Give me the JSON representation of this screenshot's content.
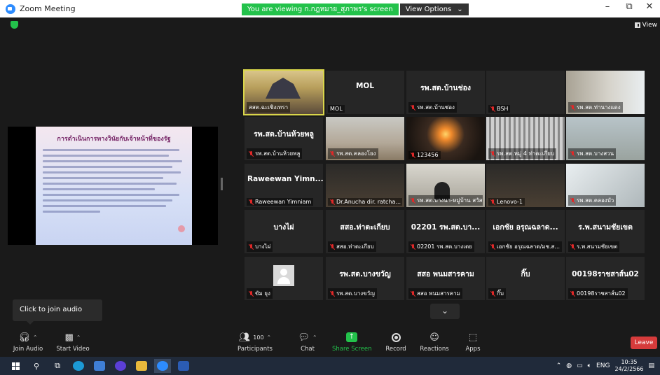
{
  "window": {
    "title": "Zoom Meeting",
    "minimize": "–",
    "maximize": "⧉",
    "close": "✕"
  },
  "banner": {
    "sharing_text": "You are viewing ก.กฎหมาย_สุภาพร's screen",
    "view_options": "View Options",
    "view_options_caret": "⌄"
  },
  "view_button": {
    "label": "View"
  },
  "slide": {
    "title": "การดำเนินการทางวินัยกับเจ้าหน้าที่ของรัฐ"
  },
  "gallery": {
    "tiles": [
      {
        "name": "",
        "label": "สสต.ฉะเชิงเทรา",
        "video": "v-bridge",
        "active": true,
        "muted": false
      },
      {
        "name": "MOL",
        "label": "MOL",
        "video": "",
        "active": false,
        "muted": false
      },
      {
        "name": "รพ.สต.บ้านช่อง",
        "label": "รพ.สต.บ้านช่อง",
        "video": "",
        "active": false,
        "muted": true
      },
      {
        "name": "",
        "label": "BSH",
        "video": "",
        "active": false,
        "muted": true
      },
      {
        "name": "",
        "label": "รพ.สต.ท่านางแดง",
        "video": "v-shelf",
        "active": false,
        "muted": true
      },
      {
        "name": "รพ.สต.บ้านห้วยพลู",
        "label": "รพ.สต.บ้านห้วยพลู",
        "video": "",
        "active": false,
        "muted": true
      },
      {
        "name": "",
        "label": "รพ.สต.คลองโยง",
        "video": "v-room",
        "active": false,
        "muted": true
      },
      {
        "name": "",
        "label": "123456",
        "video": "v-sun",
        "active": false,
        "muted": true
      },
      {
        "name": "",
        "label": "รพ.สต.หมู่ 4 ท่าตะเกียบ",
        "video": "v-curtain",
        "active": false,
        "muted": true
      },
      {
        "name": "",
        "label": "รพ.สต.บางสวน",
        "video": "v-office",
        "active": false,
        "muted": true
      },
      {
        "name": "Raweewan Yimn...",
        "label": "Raweewan Yimniam",
        "video": "",
        "active": false,
        "muted": true
      },
      {
        "name": "",
        "label": "Dr.Anucha  dir. ratcha...",
        "video": "v-dark",
        "active": false,
        "muted": true
      },
      {
        "name": "",
        "label": "รพ.สต.บางนา-หมู่บ้าน สวัสดิ์",
        "video": "v-meet",
        "active": false,
        "muted": true
      },
      {
        "name": "",
        "label": "Lenovo-1",
        "video": "v-dark",
        "active": false,
        "muted": true
      },
      {
        "name": "",
        "label": "รพ.สต.คลองบัว",
        "video": "v-window",
        "active": false,
        "muted": true
      },
      {
        "name": "บางไผ่",
        "label": "บางไผ่",
        "video": "",
        "active": false,
        "muted": true
      },
      {
        "name": "สสอ.ท่าตะเกียบ",
        "label": "สสอ.ท่าตะเกียบ",
        "video": "",
        "active": false,
        "muted": true
      },
      {
        "name": "02201 รพ.สต.บา...",
        "label": "02201 รพ.สต.บางเตย",
        "video": "",
        "active": false,
        "muted": true
      },
      {
        "name": "เอกชัย อรุณฉลาด...",
        "label": "เอกชัย อรุณฉลาด/มช.ส...",
        "video": "",
        "active": false,
        "muted": true
      },
      {
        "name": "ร.พ.สนามชัยเขต",
        "label": "ร.พ.สนามชัยเขต",
        "video": "",
        "active": false,
        "muted": true
      },
      {
        "name": "",
        "label": "ขัม ยุง",
        "video": "avatar",
        "active": false,
        "muted": true
      },
      {
        "name": "รพ.สต.บางขวัญ",
        "label": "รพ.สต.บางขวัญ",
        "video": "",
        "active": false,
        "muted": true
      },
      {
        "name": "สสอ พนมสารคาม",
        "label": "สสอ พนมสารคาม",
        "video": "",
        "active": false,
        "muted": true
      },
      {
        "name": "กิ๊บ",
        "label": "กิ๊บ",
        "video": "",
        "active": false,
        "muted": true
      },
      {
        "name": "00198ราชสาส์น02",
        "label": "00198ราชสาส์น02",
        "video": "",
        "active": false,
        "muted": true
      }
    ]
  },
  "tooltip": {
    "text": "Click to join audio"
  },
  "toolbar": {
    "join_audio": "Join Audio",
    "start_video": "Start Video",
    "participants": "Participants",
    "participants_count": "100",
    "chat": "Chat",
    "share_screen": "Share Screen",
    "record": "Record",
    "reactions": "Reactions",
    "apps": "Apps",
    "leave": "Leave"
  },
  "taskbar": {
    "language": "ENG",
    "time": "10:35",
    "date": "24/2/2566"
  },
  "colors": {
    "share_green": "#23c24b",
    "leave_red": "#d63b3b",
    "active_border": "#d9d64a",
    "taskbar": "#202a3a"
  }
}
